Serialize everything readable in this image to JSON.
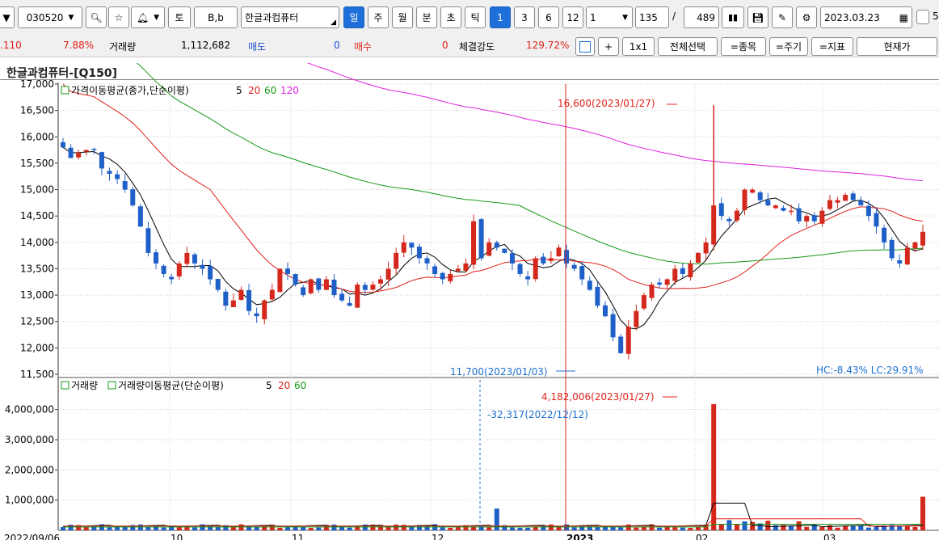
{
  "toolbar": {
    "stock_code": "030520",
    "btn_to": "토",
    "btn_bb": "B,b",
    "stock_name": "한글과컴퓨터",
    "period_tabs": [
      "일",
      "주",
      "월",
      "분",
      "초",
      "틱"
    ],
    "active_period": "일",
    "num_buttons": [
      "1",
      "3",
      "6",
      "12"
    ],
    "active_num": "1",
    "interval_select": "1",
    "count_value": "135",
    "slash": "/",
    "total_count": "489",
    "date_value": "2023.03.23",
    "checkbox_label": "5"
  },
  "inforow": {
    "change_value": ".110",
    "change_pct": "7.88%",
    "volume_label": "거래량",
    "volume_value": "1,112,682",
    "sell_label": "매도",
    "sell_value": "0",
    "buy_label": "매수",
    "buy_value": "0",
    "strength_label": "체결강도",
    "strength_value": "129.72%",
    "btn_plus": "+",
    "btn_1x1": "1x1",
    "btn_selectall": "전체선택",
    "btn_item": "=종목",
    "btn_cycle": "=주기",
    "btn_indicator": "=지표",
    "btn_current": "현재가"
  },
  "chart_title": "한글과컴퓨터-[Q150]",
  "price_panel": {
    "legend_prefix": "가격이동평균(종가,단순이평)",
    "ma_periods": [
      "5",
      "20",
      "60",
      "120"
    ],
    "ma_colors": [
      "#000000",
      "#e0201a",
      "#159a15",
      "#e020e0"
    ],
    "y_ticks": [
      "17,000",
      "16,500",
      "16,000",
      "15,500",
      "15,000",
      "14,500",
      "14,000",
      "13,500",
      "13,000",
      "12,500",
      "12,000",
      "11,500"
    ],
    "high_annotation": "16,600(2023/01/27)",
    "low_annotation": "11,700(2023/01/03)",
    "hc_lc": "HC:-8.43%  LC:29.91%"
  },
  "volume_panel": {
    "legend_label1": "거래량",
    "legend_label2": "거래량이동평균(단순이평)",
    "ma_periods": [
      "5",
      "20",
      "60"
    ],
    "y_ticks": [
      "4,000,000",
      "3,000,000",
      "2,000,000",
      "1,000,000"
    ],
    "high_annotation": "4,182,006(2023/01/27)",
    "cursor_annotation": "-32,317(2022/12/12)"
  },
  "x_labels": [
    "2022/09/06",
    "10",
    "11",
    "12",
    "2023",
    "02",
    "03"
  ],
  "colors": {
    "up": "#d4281c",
    "down": "#1f5fc8",
    "active_tab": "#1e6fd9"
  },
  "chart_data": {
    "type": "candlestick",
    "title": "한글과컴퓨터-[Q150]",
    "x_range": [
      "2022/09/06",
      "2023/03/23"
    ],
    "ylim": [
      11500,
      17000
    ],
    "ohlc_closes": [
      15800,
      15600,
      15700,
      15750,
      15750,
      15400,
      15300,
      15200,
      15000,
      14700,
      14300,
      13800,
      13600,
      13400,
      13300,
      13600,
      13800,
      13600,
      13500,
      13300,
      13100,
      12800,
      12900,
      13100,
      12700,
      12600,
      12900,
      13100,
      13500,
      13400,
      13200,
      13000,
      13300,
      13100,
      13300,
      13000,
      12900,
      12800,
      13200,
      13100,
      13200,
      13300,
      13500,
      13800,
      14000,
      13900,
      13700,
      13600,
      13400,
      13300,
      13400,
      13500,
      13600,
      14400,
      13700,
      14000,
      13900,
      13800,
      13600,
      13400,
      13300,
      13700,
      13600,
      13700,
      13900,
      13600,
      13500,
      13300,
      13100,
      12800,
      12600,
      12200,
      11900,
      12400,
      12700,
      13000,
      13200,
      13200,
      13300,
      13500,
      13400,
      13600,
      13800,
      14000,
      14700,
      14500,
      14400,
      14600,
      15000,
      15000,
      14800,
      14700,
      14700,
      14600,
      14600,
      14400,
      14500,
      14400,
      14600,
      14800,
      14800,
      14900,
      14800,
      14700,
      14500,
      14300,
      14000,
      13700,
      13600,
      13900,
      14000,
      14200
    ],
    "annotations": {
      "high": {
        "value": 16600,
        "date": "2023/01/27"
      },
      "low": {
        "value": 11700,
        "date": "2023/01/03"
      }
    },
    "hc": "-8.43%",
    "lc": "29.91%",
    "volume": {
      "ylim": [
        0,
        4500000
      ],
      "max": {
        "value": 4182006,
        "date": "2023/01/27"
      },
      "last": 1112682
    }
  }
}
